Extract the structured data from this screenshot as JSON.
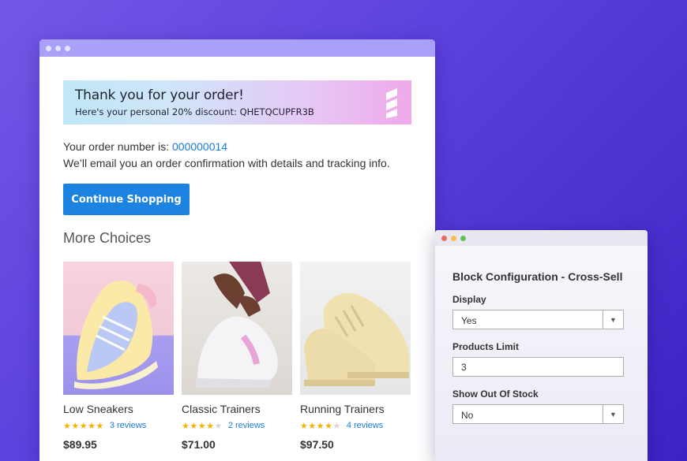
{
  "banner": {
    "title": "Thank you for your order!",
    "discount_text": "Here's your personal 20% discount: QHETQCUPFR3B"
  },
  "order": {
    "number_label": "Your order number is: ",
    "number": "000000014",
    "email_note": "We’ll email you an order confirmation with details and tracking info."
  },
  "continue_button": "Continue Shopping",
  "more_choices": {
    "title": "More Choices",
    "products": [
      {
        "name": "Low Sneakers",
        "rating": 5,
        "reviews": "3 reviews",
        "price": "$89.95"
      },
      {
        "name": "Classic Trainers",
        "rating": 4,
        "reviews": "2 reviews",
        "price": "$71.00"
      },
      {
        "name": "Running Trainers",
        "rating": 4,
        "reviews": "4 reviews",
        "price": "$97.50"
      }
    ]
  },
  "config": {
    "title": "Block Configuration - Cross-Sell",
    "display_label": "Display",
    "display_value": "Yes",
    "limit_label": "Products Limit",
    "limit_value": "3",
    "out_of_stock_label": "Show Out Of Stock",
    "out_of_stock_value": "No"
  },
  "colors": {
    "accent": "#1d83e0",
    "star": "#f5b301",
    "background": "#5a3fdc"
  }
}
